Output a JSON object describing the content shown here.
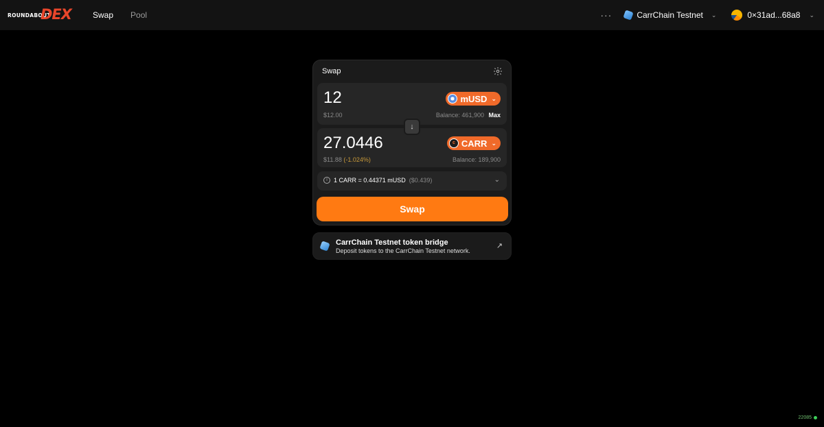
{
  "header": {
    "logo_small": "ROUNDABOUT",
    "logo_big": "DEX",
    "nav": [
      {
        "label": "Swap",
        "active": true
      },
      {
        "label": "Pool",
        "active": false
      }
    ],
    "more": "···",
    "network": "CarrChain Testnet",
    "wallet": "0×31ad...68a8"
  },
  "swap": {
    "title": "Swap",
    "input": {
      "amount": "12",
      "usd": "$12.00",
      "token": "mUSD",
      "balance": "Balance: 461,900",
      "max": "Max"
    },
    "output": {
      "amount": "27.0446",
      "usd": "$11.88",
      "change": "(-1.024%)",
      "token": "CARR",
      "balance": "Balance: 189,900"
    },
    "rate": "1 CARR = 0.44371 mUSD",
    "rate_usd": "($0.439)",
    "button": "Swap"
  },
  "bridge": {
    "title": "CarrChain Testnet token bridge",
    "subtitle": "Deposit tokens to the CarrChain Testnet network."
  },
  "block_number": "22085",
  "colors": {
    "accent": "#ff7a12",
    "token_button": "#f06a2a",
    "logo": "#e8462b"
  }
}
